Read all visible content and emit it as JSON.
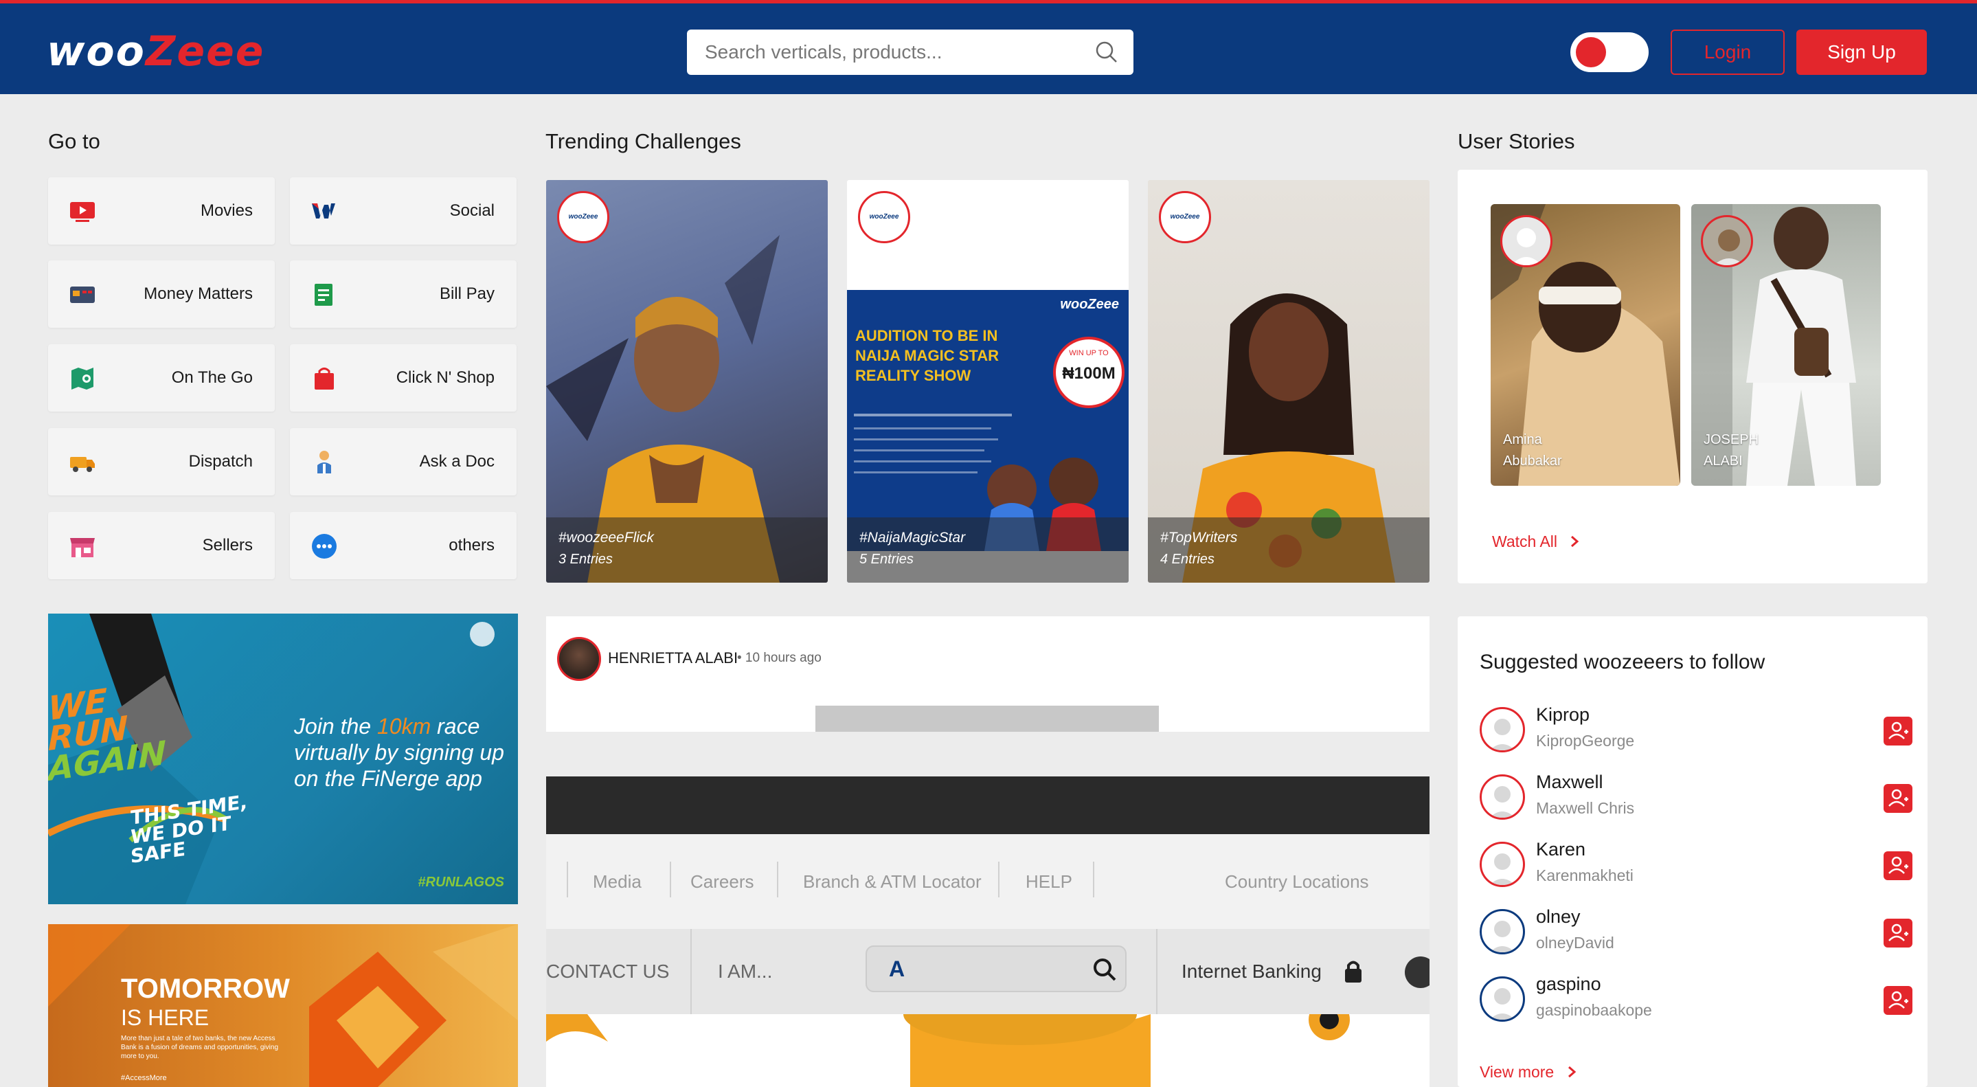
{
  "header": {
    "logo_left": "woo",
    "logo_right": "Zeee",
    "search_placeholder": "Search verticals, products...",
    "login_label": "Login",
    "signup_label": "Sign Up",
    "colors": {
      "brand_blue": "#0b3a7e",
      "brand_red": "#e3262c"
    }
  },
  "goto": {
    "title": "Go to",
    "items": [
      {
        "label": "Movies",
        "icon": "movie-icon"
      },
      {
        "label": "Social",
        "icon": "social-icon"
      },
      {
        "label": "Money Matters",
        "icon": "card-icon"
      },
      {
        "label": "Bill Pay",
        "icon": "bill-icon"
      },
      {
        "label": "On The Go",
        "icon": "map-icon"
      },
      {
        "label": "Click N' Shop",
        "icon": "shopping-bag-icon"
      },
      {
        "label": "Dispatch",
        "icon": "truck-icon"
      },
      {
        "label": "Ask a Doc",
        "icon": "doctor-icon"
      },
      {
        "label": "Sellers",
        "icon": "store-icon"
      },
      {
        "label": "others",
        "icon": "more-icon"
      }
    ]
  },
  "banner1": {
    "headline_lines": [
      "WE",
      "RUN",
      "AGAIN"
    ],
    "tagline": "THIS TIME, WE DO IT SAFE",
    "body_pre": "Join the ",
    "body_highlight": "10km",
    "body_post": " race virtually by signing up on the FiNerge app",
    "hashtag": "#RUNLAGOS"
  },
  "banner2": {
    "headline": "TOMORROW",
    "subhead": "IS HERE",
    "body": "More than just a tale of two banks, the new Access Bank is a fusion of dreams and opportunities, giving more to you.",
    "hashtag": "#AccessMore"
  },
  "trending": {
    "title": "Trending Challenges",
    "avatar_text": "wooZeee",
    "items": [
      {
        "tag": "#woozeeeFlick",
        "entries": "3 Entries"
      },
      {
        "tag": "#NaijaMagicStar",
        "entries": "5 Entries"
      },
      {
        "tag": "#TopWriters",
        "entries": "4 Entries"
      }
    ],
    "poster": {
      "brand": "wooZeee",
      "line1": "AUDITION TO BE IN",
      "line2": "NAIJA MAGIC STAR",
      "line3": "REALITY SHOW",
      "badge_small": "WIN UP TO",
      "prize": "₦100M"
    }
  },
  "post": {
    "name": "HENRIETTA ALABI",
    "time": "• 10 hours ago"
  },
  "bank": {
    "nav": [
      "Media",
      "Careers",
      "Branch & ATM Locator",
      "HELP",
      "Country Locations"
    ],
    "row": {
      "contact": "CONTACT US",
      "iam": "I AM...",
      "search_value": "A",
      "internet_banking": "Internet Banking"
    }
  },
  "stories": {
    "title": "User Stories",
    "items": [
      {
        "name_line1": "Amina",
        "name_line2": "Abubakar"
      },
      {
        "name_line1": "JOSEPH",
        "name_line2": "ALABI"
      }
    ],
    "watch_all": "Watch All"
  },
  "suggested": {
    "title": "Suggested woozeeers to follow",
    "users": [
      {
        "name": "Kiprop",
        "handle": "KipropGeorge"
      },
      {
        "name": "Maxwell",
        "handle": "Maxwell Chris"
      },
      {
        "name": "Karen",
        "handle": "Karenmakheti"
      },
      {
        "name": "olney",
        "handle": "olneyDavid"
      },
      {
        "name": "gaspino",
        "handle": "gaspinobaakope"
      }
    ],
    "view_more": "View more"
  }
}
